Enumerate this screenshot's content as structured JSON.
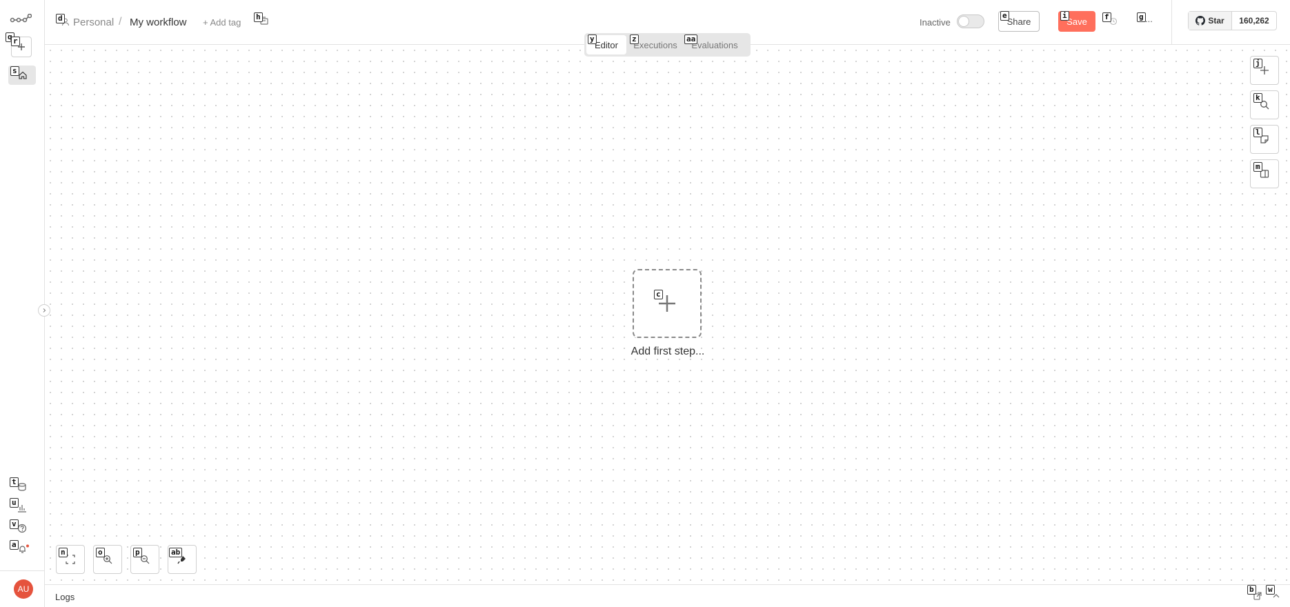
{
  "colors": {
    "accent": "#ff6f5c",
    "avatar": "#e5533d"
  },
  "header": {
    "project": "Personal",
    "separator": "/",
    "workflow_name": "My workflow",
    "add_tag": "+ Add tag",
    "status_label": "Inactive",
    "share_label": "Share",
    "save_label": "Save",
    "github_star_label": "Star",
    "github_star_count": "160,262",
    "more_label": "..."
  },
  "tabs": [
    {
      "label": "Editor",
      "active": true
    },
    {
      "label": "Executions",
      "active": false
    },
    {
      "label": "Evaluations",
      "active": false
    }
  ],
  "canvas": {
    "add_first_step": "Add first step..."
  },
  "sidebar": {
    "avatar_initials": "AU"
  },
  "logs": {
    "label": "Logs"
  },
  "hints": {
    "a": "a",
    "b": "b",
    "c": "c",
    "d": "d",
    "e": "e",
    "f": "f",
    "g": "g",
    "h": "h",
    "i": "i",
    "j": "j",
    "k": "k",
    "l": "l",
    "m": "m",
    "n": "n",
    "o": "o",
    "p": "p",
    "q": "q",
    "r": "r",
    "s": "s",
    "t": "t",
    "u": "u",
    "v": "v",
    "w": "w",
    "y": "y",
    "z": "z",
    "aa": "aa",
    "ab": "ab"
  }
}
